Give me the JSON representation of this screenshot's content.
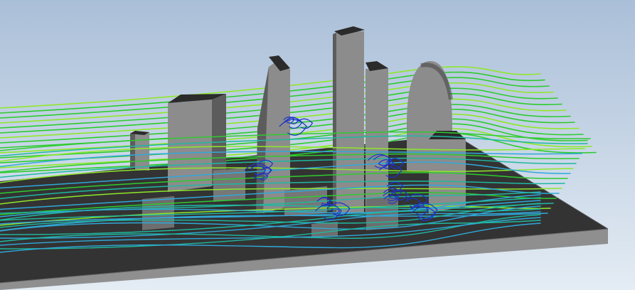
{
  "scene": {
    "subject": "cfd-streamlines-over-city-model",
    "colors": {
      "background_top": "#aabfd8",
      "background_bottom": "#e4ecf4",
      "ground_top": "#333333",
      "ground_side": "#8f8f8f",
      "building_front": "#8c8c8c",
      "building_side": "#5c5c5c",
      "building_top": "#2b2b2b",
      "stream_green": "#2ecb2e",
      "stream_lime": "#8ee82a",
      "stream_teal": "#1fb8a0",
      "stream_cyan": "#30a8d8",
      "stream_blue": "#1c34c8"
    }
  }
}
